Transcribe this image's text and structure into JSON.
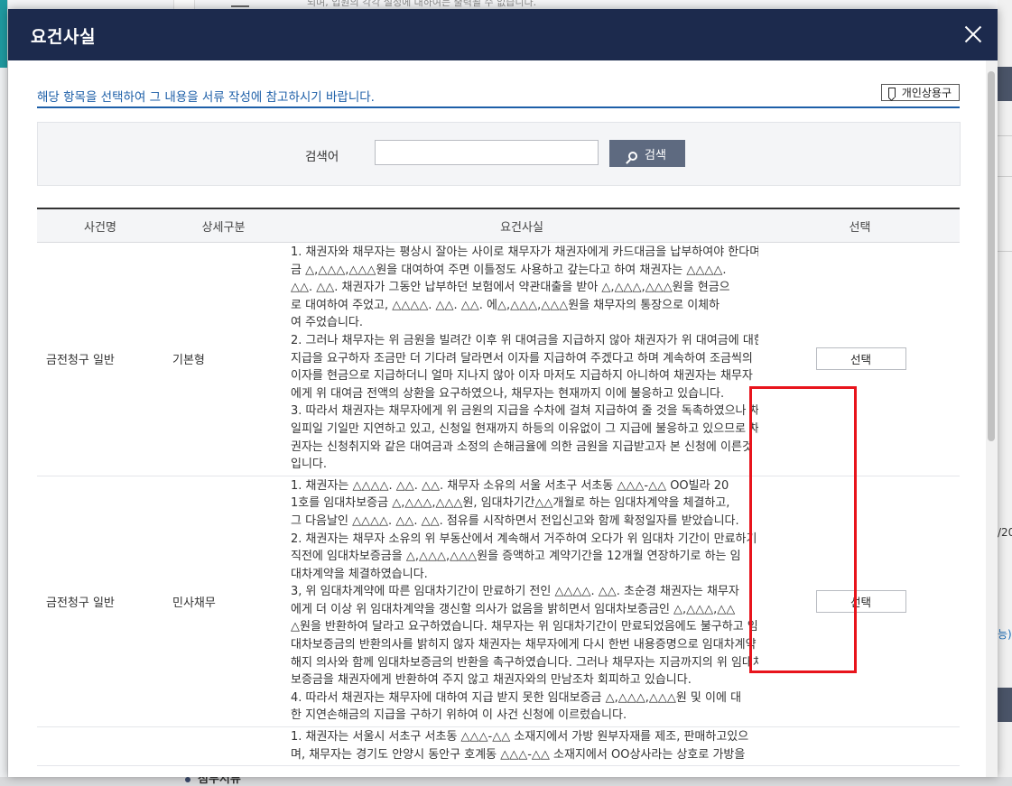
{
  "background": {
    "top_note": "되며, 입원의 각각 설정에 대하여는 출력될 수 없습니다.",
    "right_partial_date": "/20",
    "right_partial_link": "능)",
    "bottom_section": "첨부서류"
  },
  "modal": {
    "title": "요건사실",
    "close_icon": "close-icon",
    "guide_text": "해당 항목을 선택하여 그 내용을 서류 작성에 참고하시기 바랍니다.",
    "personal_button": "개인상용구",
    "search": {
      "label": "검색어",
      "value": "",
      "placeholder": "",
      "button": "검색"
    },
    "table": {
      "headers": [
        "사건명",
        "상세구분",
        "요건사실",
        "선택"
      ],
      "rows": [
        {
          "case": "금전청구 일반",
          "detail": "기본형",
          "select": "선택",
          "fact_lines": [
            "1. 채권자와 채무자는 평상시 잘아는 사이로 채무자가 채권자에게 카드대금을 납부하여야 한다며",
            "금 △,△△△,△△△원을 대여하여 주면 이틀정도 사용하고 갚는다고 하여 채권자는 △△△△.",
            "△△. △△. 채권자가 그동안 납부하던 보험에서 약관대출을 받아 △,△△△,△△△원을 현금으",
            "로 대여하여 주었고, △△△△. △△. △△. 에△,△△△,△△△원을 채무자의 통장으로 이체하",
            "여 주었습니다.",
            "2. 그러나 채무자는 위 금원을 빌려간 이후 위 대여금을 지급하지 않아 채권자가 위 대여금에 대한",
            "지급을 요구하자 조금만 더 기다려 달라면서 이자를 지급하여 주겠다고 하며 계속하여 조금씩의",
            "이자를 현금으로 지급하더니 얼마 지나지 않아 이자 마저도 지급하지 아니하여 채권자는 채무자",
            "에게 위 대여금 전액의 상환을 요구하였으나, 채무자는 현재까지 이에 불응하고 있습니다.",
            "3. 따라서 채권자는 채무자에게 위 금원의 지급을 수차에 걸쳐 지급하여 줄 것을 독촉하였으나 채",
            "일피일 기일만 지연하고 있고, 신청일 현재까지 하등의 이유없이 그 지급에 불응하고 있으므로 채",
            "권자는 신청취지와 같은 대여금과 소정의 손해금율에 의한 금원을 지급받고자 본 신청에 이른것",
            "입니다."
          ]
        },
        {
          "case": "금전청구 일반",
          "detail": "민사채무",
          "select": "선택",
          "fact_lines": [
            "1. 채권자는 △△△△. △△. △△. 채무자 소유의 서울 서초구 서초동 △△△-△△ OO빌라 20",
            "1호를 임대차보증금 △,△△△,△△△원, 임대차기간△△개월로 하는 임대차계약을 체결하고,",
            "그 다음날인 △△△△. △△. △△. 점유를 시작하면서 전입신고와 함께 확정일자를 받았습니다.",
            "2. 채권자는 채무자 소유의 위 부동산에서 계속해서 거주하여 오다가 위 임대차 기간이 만료하기",
            "직전에 임대차보증금을 △,△△△,△△△원을 증액하고 계약기간을 12개월 연장하기로 하는 임",
            "대차계약을 체결하였습니다.",
            "3, 위 임대차계약에 따른 임대차기간이 만료하기 전인 △△△△. △△. 초순경 채권자는 채무자",
            "에게 더 이상 위 임대차계약을 갱신할 의사가 없음을 밝히면서 임대차보증금인 △,△△△,△△",
            "△원을 반환하여 달라고 요구하였습니다. 채무자는 위 임대차기간이 만료되었음에도 불구하고 임",
            "대차보증금의 반환의사를 밝히지 않자 채권자는 채무자에게 다시 한번 내용증명으로 임대차계약",
            "해지 의사와 함께 임대차보증금의 반환을 촉구하였습니다. 그러나 채무자는 지금까지의 위 임대차",
            "보증금을 채권자에게 반환하여 주지 않고 채권자와의 만남조차 회피하고 있습니다.",
            "4. 따라서 채권자는 채무자에 대하여 지급 받지 못한 임대보증금 △,△△△,△△△원 및 이에 대",
            "한 지연손해금의 지급을 구하기 위하여 이 사건 신청에 이르렀습니다."
          ]
        },
        {
          "case": "",
          "detail": "",
          "select": "",
          "fact_lines": [
            "1. 채권자는 서울시 서초구 서초동 △△△-△△ 소재지에서 가방 원부자재를 제조, 판매하고있으",
            "며, 채무자는 경기도 안양시 동안구 호계동 △△△-△△ 소재지에서 OO상사라는 상호로 가방을"
          ]
        }
      ]
    }
  }
}
